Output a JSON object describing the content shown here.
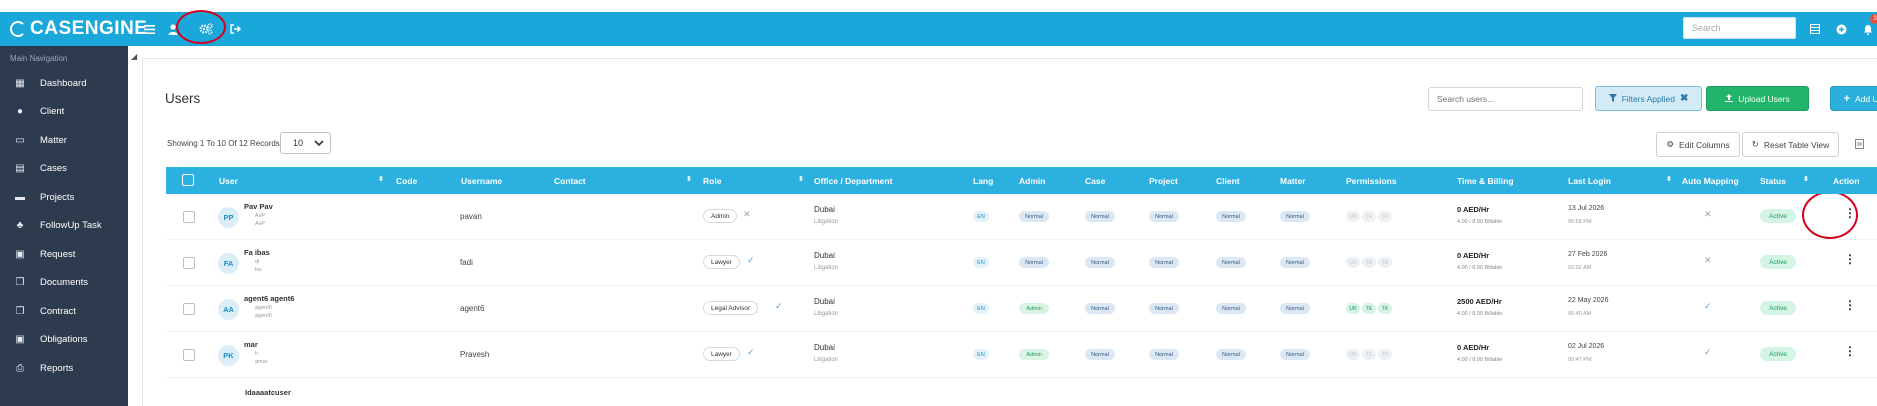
{
  "brand": {
    "name": "CASENGINE"
  },
  "topbar": {
    "search_placeholder": "Search",
    "icons": [
      "menu-icon",
      "user-icon",
      "settings-cogs-icon",
      "logout-icon",
      "grid-icon",
      "plus-circle-icon",
      "bell-icon"
    ],
    "notification_count": "3"
  },
  "sidebar": {
    "heading": "Main Navigation",
    "items": [
      {
        "label": "Dashboard",
        "icon": "grid-icon"
      },
      {
        "label": "Client",
        "icon": "person-icon"
      },
      {
        "label": "Matter",
        "icon": "folder-icon"
      },
      {
        "label": "Cases",
        "icon": "document-icon"
      },
      {
        "label": "Projects",
        "icon": "briefcase-icon"
      },
      {
        "label": "FollowUp Task",
        "icon": "task-icon"
      },
      {
        "label": "Request",
        "icon": "calendar-icon"
      },
      {
        "label": "Documents",
        "icon": "documents-icon"
      },
      {
        "label": "Contract",
        "icon": "contract-icon"
      },
      {
        "label": "Obligations",
        "icon": "calendar-icon"
      },
      {
        "label": "Reports",
        "icon": "print-icon"
      }
    ]
  },
  "page": {
    "title": "Users",
    "search_placeholder": "Search users...",
    "filters_label": "Filters Applied",
    "upload_label": "Upload Users",
    "add_label": "Add User",
    "records_text": "Showing 1 To 10 Of 12 Records",
    "rows_per_page": "10",
    "edit_columns_label": "Edit Columns",
    "reset_view_label": "Reset Table View"
  },
  "table": {
    "columns": [
      "User",
      "Code",
      "Username",
      "Contact",
      "Role",
      "Office / Department",
      "Lang",
      "Admin",
      "Case",
      "Project",
      "Client",
      "Matter",
      "Permissions",
      "Time & Billing",
      "Last Login",
      "Auto Mapping",
      "Status",
      "Action"
    ],
    "rows": [
      {
        "initials": "PP",
        "name": "Pav Pav",
        "sub1": "AvP",
        "sub2": "AvP",
        "username": "pavan",
        "role": "Admin",
        "role_mark": "✕",
        "office": "Dubai",
        "department": "Litigation",
        "lang": "EN",
        "admin": "Normal",
        "case": "Normal",
        "project": "Normal",
        "client": "Normal",
        "matter": "Normal",
        "permissions": [
          "UR",
          "TE",
          "TK"
        ],
        "permissions_active": false,
        "rate": "0 AED/Hr",
        "billable": "4.00 / 8.00 Billable",
        "login_date": "13 Jul 2026",
        "login_time": "05:58 PM",
        "auto_mapping": "✕",
        "status": "Active"
      },
      {
        "initials": "FA",
        "name": "Fa     ibas",
        "sub1": "di",
        "sub2": "ba",
        "username": "fadi",
        "role": "Lawyer",
        "role_mark": "✓",
        "office": "Dubai",
        "department": "Litigation",
        "lang": "EN",
        "admin": "Normal",
        "case": "Normal",
        "project": "Normal",
        "client": "Normal",
        "matter": "Normal",
        "permissions": [
          "UR",
          "TE",
          "TK"
        ],
        "permissions_active": false,
        "rate": "0 AED/Hr",
        "billable": "4.00 / 8.00 Billable",
        "login_date": "27 Feb 2026",
        "login_time": "02:02 AM",
        "auto_mapping": "✕",
        "status": "Active"
      },
      {
        "initials": "AA",
        "name": "agent6 agent6",
        "sub1": "agent6",
        "sub2": "agent6",
        "username": "agent6",
        "role": "Legal Advisor",
        "role_mark": "✓",
        "office": "Dubai",
        "department": "Litigation",
        "lang": "EN",
        "admin": "Admin",
        "case": "Normal",
        "project": "Normal",
        "client": "Normal",
        "matter": "Normal",
        "permissions": [
          "UR",
          "TE",
          "TK"
        ],
        "permissions_active": true,
        "rate": "2500 AED/Hr",
        "billable": "4.00 / 8.00 Billable",
        "login_date": "22 May 2026",
        "login_time": "06:40 AM",
        "auto_mapping": "✓",
        "status": "Active"
      },
      {
        "initials": "PK",
        "name": "mar",
        "sub1": "h",
        "sub2": "amar",
        "username": "Pravesh",
        "role": "Lawyer",
        "role_mark": "✓",
        "office": "Dubai",
        "department": "Litigation",
        "lang": "EN",
        "admin": "Admin",
        "case": "Normal",
        "project": "Normal",
        "client": "Normal",
        "matter": "Normal",
        "permissions": [
          "UR",
          "TE",
          "TK"
        ],
        "permissions_active": false,
        "rate": "0 AED/Hr",
        "billable": "4.00 / 8.00 Billable",
        "login_date": "02 Jul 2026",
        "login_time": "00:47 PM",
        "auto_mapping": "✓",
        "status": "Active"
      }
    ],
    "partial_row_name": "Idaaaatcuser"
  },
  "colors": {
    "topbar": "#1aa7da",
    "sidebar": "#2e3a4e",
    "table_header": "#2bb0e0",
    "upload_button": "#21b46a",
    "annotation": "#d6001c"
  }
}
